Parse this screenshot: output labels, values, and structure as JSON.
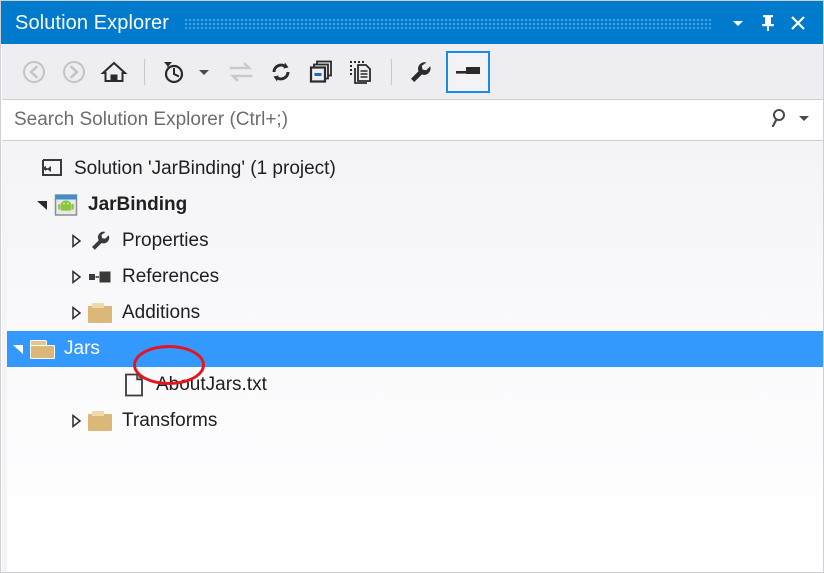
{
  "window": {
    "title": "Solution Explorer",
    "accent_color": "#007acc",
    "selection_color": "#3399ff",
    "annotation_color": "#e8141b",
    "controls": [
      {
        "name": "window-menu-chevron",
        "label": "▼"
      },
      {
        "name": "pin",
        "label": "Pin"
      },
      {
        "name": "close",
        "label": "Close"
      }
    ]
  },
  "toolbar": {
    "buttons": [
      {
        "name": "back",
        "label": "Back",
        "enabled": false
      },
      {
        "name": "forward",
        "label": "Forward",
        "enabled": false
      },
      {
        "name": "home",
        "label": "Home",
        "enabled": true
      },
      {
        "name": "pending-changes-filter",
        "label": "Pending Changes Filter",
        "enabled": true
      },
      {
        "name": "pending-changes-dropdown",
        "label": "Filter options",
        "enabled": true
      },
      {
        "name": "sync-with-active-document",
        "label": "Sync with Active Document",
        "enabled": false
      },
      {
        "name": "refresh",
        "label": "Refresh",
        "enabled": true
      },
      {
        "name": "collapse-all",
        "label": "Collapse All",
        "enabled": true
      },
      {
        "name": "show-all-files",
        "label": "Show All Files",
        "enabled": true
      },
      {
        "name": "properties",
        "label": "Properties",
        "enabled": true
      },
      {
        "name": "preview-selected-items",
        "label": "Preview Selected Items",
        "enabled": true,
        "toggled": true
      }
    ]
  },
  "search": {
    "value": "",
    "placeholder": "Search Solution Explorer (Ctrl+;)",
    "icon": "search-icon",
    "dropdown_icon": "chevron-down-icon"
  },
  "tree": {
    "nodes": [
      {
        "name": "solution-node",
        "label": "Solution 'JarBinding' (1 project)",
        "icon": "solution-icon",
        "indent": 0,
        "twisty": "none",
        "bold": false,
        "selected": false
      },
      {
        "name": "project-node-jarbinding",
        "label": "JarBinding",
        "icon": "android-project-icon",
        "indent": 1,
        "twisty": "expanded",
        "bold": true,
        "selected": false
      },
      {
        "name": "node-properties",
        "label": "Properties",
        "icon": "wrench-icon",
        "indent": 2,
        "twisty": "collapsed",
        "bold": false,
        "selected": false
      },
      {
        "name": "node-references",
        "label": "References",
        "icon": "references-icon",
        "indent": 2,
        "twisty": "collapsed",
        "bold": false,
        "selected": false
      },
      {
        "name": "node-additions",
        "label": "Additions",
        "icon": "folder-closed-icon",
        "indent": 2,
        "twisty": "collapsed",
        "bold": false,
        "selected": false
      },
      {
        "name": "node-jars",
        "label": "Jars",
        "icon": "folder-open-icon",
        "indent": 2,
        "twisty": "expanded",
        "bold": false,
        "selected": true
      },
      {
        "name": "node-aboutjars-txt",
        "label": "AboutJars.txt",
        "icon": "document-icon",
        "indent": 3,
        "twisty": "none",
        "bold": false,
        "selected": false
      },
      {
        "name": "node-transforms",
        "label": "Transforms",
        "icon": "folder-closed-icon",
        "indent": 2,
        "twisty": "collapsed",
        "bold": false,
        "selected": false
      }
    ]
  }
}
